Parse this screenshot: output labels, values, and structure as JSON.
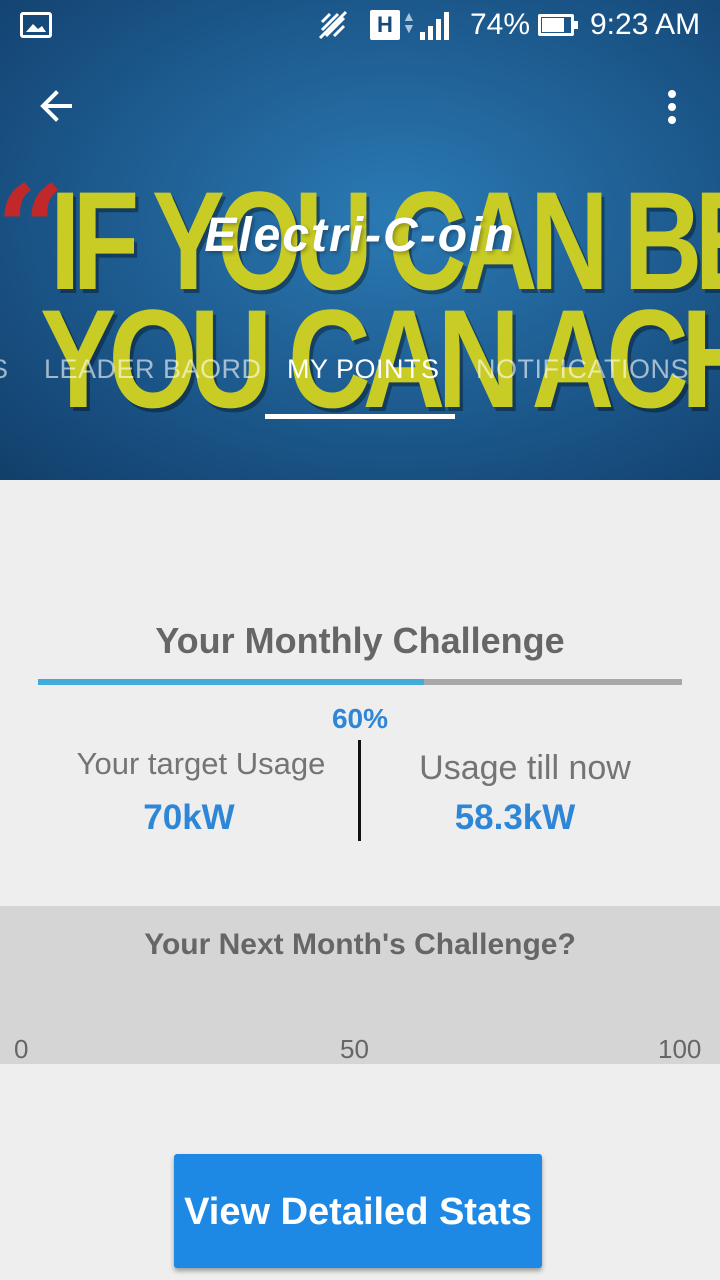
{
  "status_bar": {
    "battery_percent": "74%",
    "time": "9:23 AM",
    "network_badge": "H",
    "icons": [
      "gallery-icon",
      "mute-icon",
      "network-h-icon",
      "signal-icon",
      "battery-icon"
    ]
  },
  "toolbar": {
    "title": "Electri-C-oin",
    "back_icon": "arrow-back-icon",
    "menu_icon": "more-vert-icon"
  },
  "banner": {
    "quote_mark": "“",
    "line1": "IF YOU CAN BELIEV",
    "line2": "YOU CAN ACHIEV",
    "colors": {
      "background": "#1f5f94",
      "text": "#c9cc24",
      "quote": "#c0282a"
    }
  },
  "tabs": {
    "items": [
      {
        "label": "S",
        "active": false
      },
      {
        "label": "LEADER BAORD",
        "active": false
      },
      {
        "label": "MY POINTS",
        "active": true
      },
      {
        "label": "NOTIFICATIONS",
        "active": false
      }
    ]
  },
  "monthly_challenge": {
    "title": "Your Monthly Challenge",
    "progress_percent": 60,
    "progress_label": "60%",
    "target_label": "Your target Usage",
    "target_value": "70kW",
    "usage_label": "Usage till now",
    "usage_value": "58.3kW"
  },
  "next_month": {
    "title": "Your Next Month's Challenge?",
    "scale_labels": [
      "0",
      "50",
      "100"
    ]
  },
  "actions": {
    "view_stats_label": "View Detailed Stats"
  },
  "colors": {
    "accent": "#2e86d6",
    "progress_fill": "#43abd9",
    "button": "#1e88e5",
    "page_background": "#eeeeee"
  }
}
